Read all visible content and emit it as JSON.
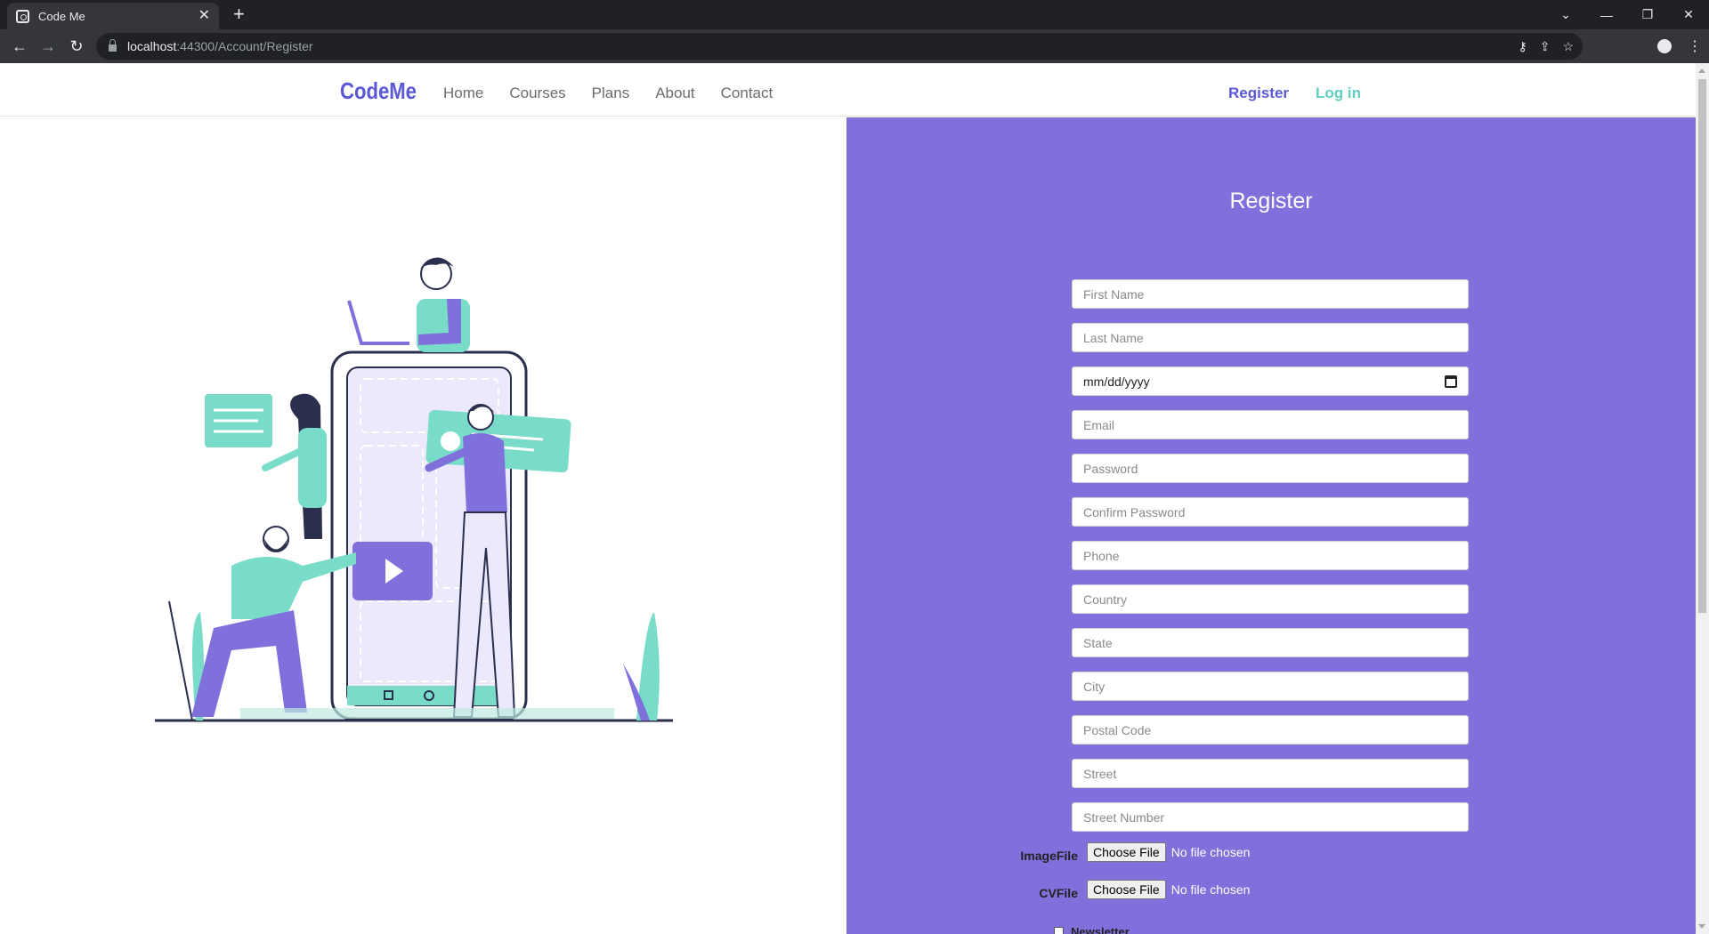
{
  "browser": {
    "tab_title": "Code Me",
    "url_host": "localhost",
    "url_rest": ":44300/Account/Register"
  },
  "nav": {
    "brand": "CodeMe",
    "links": [
      "Home",
      "Courses",
      "Plans",
      "About",
      "Contact"
    ],
    "register": "Register",
    "login": "Log in"
  },
  "form": {
    "title": "Register",
    "fields": {
      "first_name": "First Name",
      "last_name": "Last Name",
      "birth_date": "mm/dd/yyyy",
      "email": "Email",
      "password": "Password",
      "confirm_password": "Confirm Password",
      "phone": "Phone",
      "country": "Country",
      "state": "State",
      "city": "City",
      "postal_code": "Postal Code",
      "street": "Street",
      "street_number": "Street Number"
    },
    "image_file": {
      "label": "ImageFile",
      "button": "Choose File",
      "status": "No file chosen"
    },
    "cv_file": {
      "label": "CVFile",
      "button": "Choose File",
      "status": "No file chosen"
    },
    "newsletter": "Newsletter"
  },
  "colors": {
    "panel": "#8070dc",
    "brand": "#5b58d6",
    "accent_teal": "#5fcfc1",
    "illustration_purple": "#8070dc",
    "illustration_teal": "#79dcc8",
    "illustration_navy": "#2b2f4e"
  }
}
